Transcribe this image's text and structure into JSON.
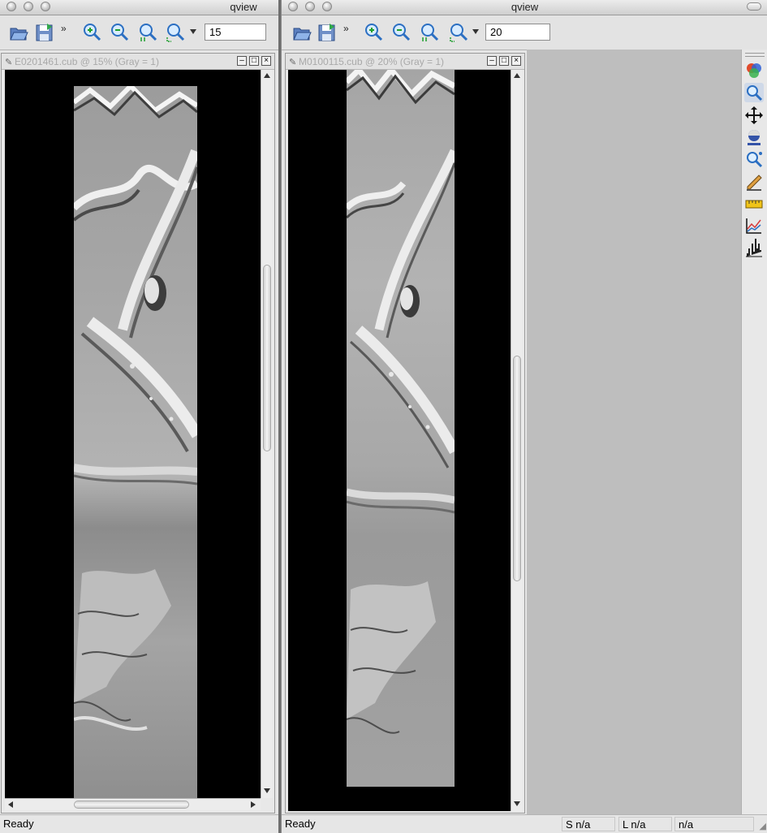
{
  "left_window": {
    "title": "qview",
    "zoom_value": "15",
    "subwindow_title": "E0201461.cub @ 15% (Gray = 1)",
    "status": "Ready"
  },
  "right_window": {
    "title": "qview",
    "zoom_value": "20",
    "subwindow_title": "M0100115.cub @ 20% (Gray = 1)",
    "status": "Ready",
    "status_sample": "S n/a",
    "status_line": "L n/a",
    "status_dn": "n/a"
  },
  "toolbar": {
    "more_glyph": "»",
    "icons": [
      "open-file-icon",
      "save-file-icon",
      "zoom-in-icon",
      "zoom-out-icon",
      "zoom-actual-icon",
      "zoom-fit-icon"
    ]
  },
  "tool_palette": [
    {
      "icon": "color-band-icon",
      "active": false
    },
    {
      "icon": "zoom-tool-icon",
      "active": true
    },
    {
      "icon": "pan-tool-icon",
      "active": false
    },
    {
      "icon": "stretch-tool-icon",
      "active": false
    },
    {
      "icon": "find-tool-icon",
      "active": false
    },
    {
      "icon": "edit-tool-icon",
      "active": false
    },
    {
      "icon": "measure-tool-icon",
      "active": false
    },
    {
      "icon": "spectral-plot-icon",
      "active": false
    },
    {
      "icon": "histogram-icon",
      "active": false
    }
  ]
}
